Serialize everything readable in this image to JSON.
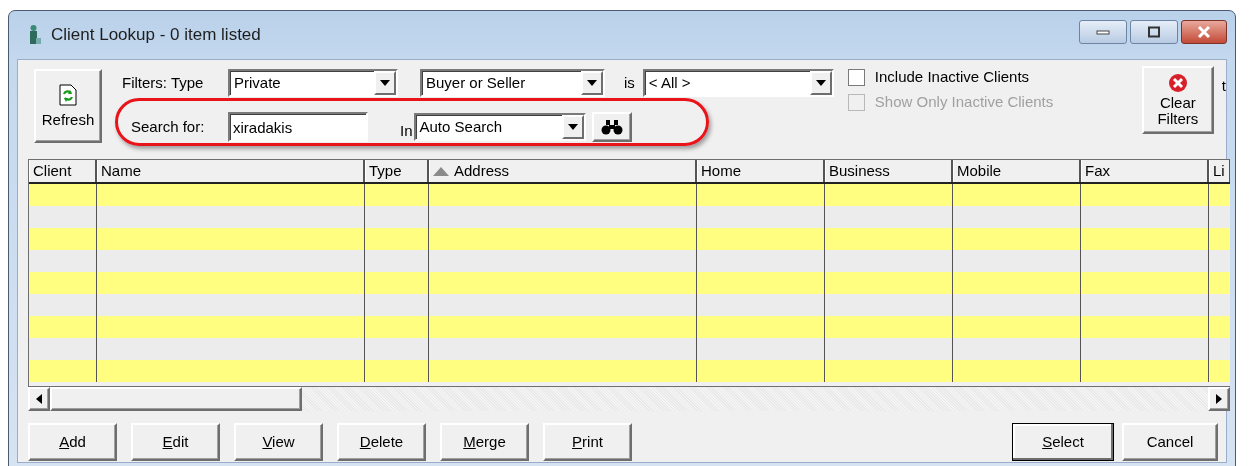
{
  "window": {
    "title": "Client Lookup - 0 item listed"
  },
  "toolbar": {
    "refresh_button": "Refresh",
    "filters_label": "Filters: Type",
    "type_filter": {
      "value": "Private"
    },
    "role_filter": {
      "value": "Buyer or Seller"
    },
    "is_label": "is",
    "value_filter": {
      "value": "< All >"
    },
    "search_label": "Search for:",
    "search": {
      "value": "xiradakis"
    },
    "in_label": "In",
    "search_in": {
      "value": "Auto Search"
    },
    "checkboxes": [
      {
        "label": "Include Inactive Clients",
        "checked": false,
        "disabled": false
      },
      {
        "label": "Show Only Inactive Clients",
        "checked": false,
        "disabled": true
      }
    ],
    "clear_button": "Clear Filters",
    "cut_label": "t"
  },
  "table": {
    "columns": [
      {
        "label": "Client",
        "sorted": false
      },
      {
        "label": "Name",
        "sorted": false
      },
      {
        "label": "Type",
        "sorted": false
      },
      {
        "label": "Address",
        "sorted": true
      },
      {
        "label": "Home",
        "sorted": false
      },
      {
        "label": "Business",
        "sorted": false
      },
      {
        "label": "Mobile",
        "sorted": false
      },
      {
        "label": "Fax",
        "sorted": false
      },
      {
        "label": "Li",
        "sorted": false
      }
    ]
  },
  "buttons_left": [
    {
      "label": "Add",
      "underline_first": true
    },
    {
      "label": "Edit",
      "underline_first": true
    },
    {
      "label": "View",
      "underline_first": true
    },
    {
      "label": "Delete",
      "underline_first": true
    },
    {
      "label": "Merge",
      "underline_first": true
    },
    {
      "label": "Print",
      "underline_first": true
    }
  ],
  "buttons_right": [
    {
      "label": "Select",
      "underline_first": true,
      "default": true
    },
    {
      "label": "Cancel",
      "underline_first": false,
      "default": false
    }
  ]
}
